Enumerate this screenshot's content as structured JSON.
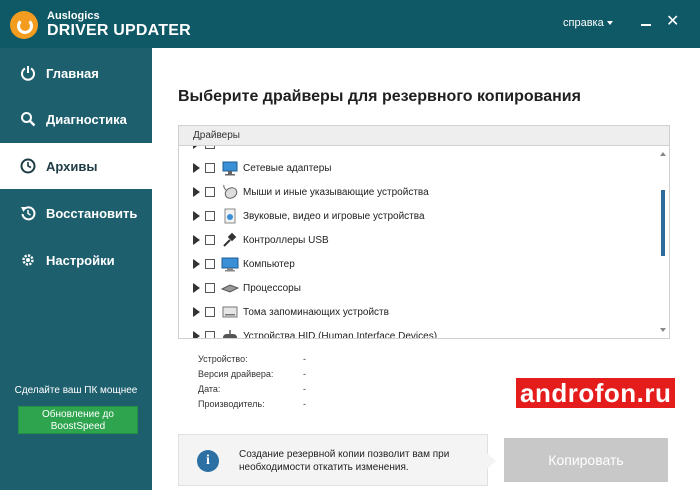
{
  "app": {
    "brand_small": "Auslogics",
    "brand_big": "DRIVER UPDATER",
    "help_menu": "справка",
    "colors": {
      "sidebar": "#1e5f6e",
      "accent_orange": "#f39c1f",
      "promo_green": "#2ea44f",
      "info_blue": "#2b6fa3"
    }
  },
  "sidebar": {
    "items": [
      {
        "label": "Главная",
        "icon": "power-icon",
        "active": false
      },
      {
        "label": "Диагностика",
        "icon": "search-icon",
        "active": false
      },
      {
        "label": "Архивы",
        "icon": "clock-icon",
        "active": true
      },
      {
        "label": "Восстановить",
        "icon": "restore-icon",
        "active": false
      },
      {
        "label": "Настройки",
        "icon": "gear-icon",
        "active": false
      }
    ],
    "promo_text": "Сделайте ваш ПК мощнее",
    "promo_button_line1": "Обновление до",
    "promo_button_line2": "BoostSpeed"
  },
  "main": {
    "title": "Выберите драйверы для резервного копирования",
    "tree_header": "Драйверы",
    "tree_rows": [
      {
        "label": "Сетевые адаптеры",
        "icon": "network-adapter-icon"
      },
      {
        "label": "Мыши и иные указывающие устройства",
        "icon": "mouse-icon"
      },
      {
        "label": "Звуковые, видео и игровые устройства",
        "icon": "sound-icon"
      },
      {
        "label": "Контроллеры USB",
        "icon": "usb-icon"
      },
      {
        "label": "Компьютер",
        "icon": "computer-icon"
      },
      {
        "label": "Процессоры",
        "icon": "processor-icon"
      },
      {
        "label": "Тома запоминающих устройств",
        "icon": "storage-icon"
      },
      {
        "label": "Устройства HID (Human Interface Devices)",
        "icon": "hid-icon"
      }
    ],
    "details": [
      {
        "label": "Устройство:",
        "value": "-"
      },
      {
        "label": "Версия драйвера:",
        "value": "-"
      },
      {
        "label": "Дата:",
        "value": "-"
      },
      {
        "label": "Производитель:",
        "value": "-"
      }
    ],
    "info_text": "Создание резервной копии позволит вам при необходимости откатить изменения.",
    "copy_button": "Копировать",
    "watermark": "androfon.ru"
  }
}
